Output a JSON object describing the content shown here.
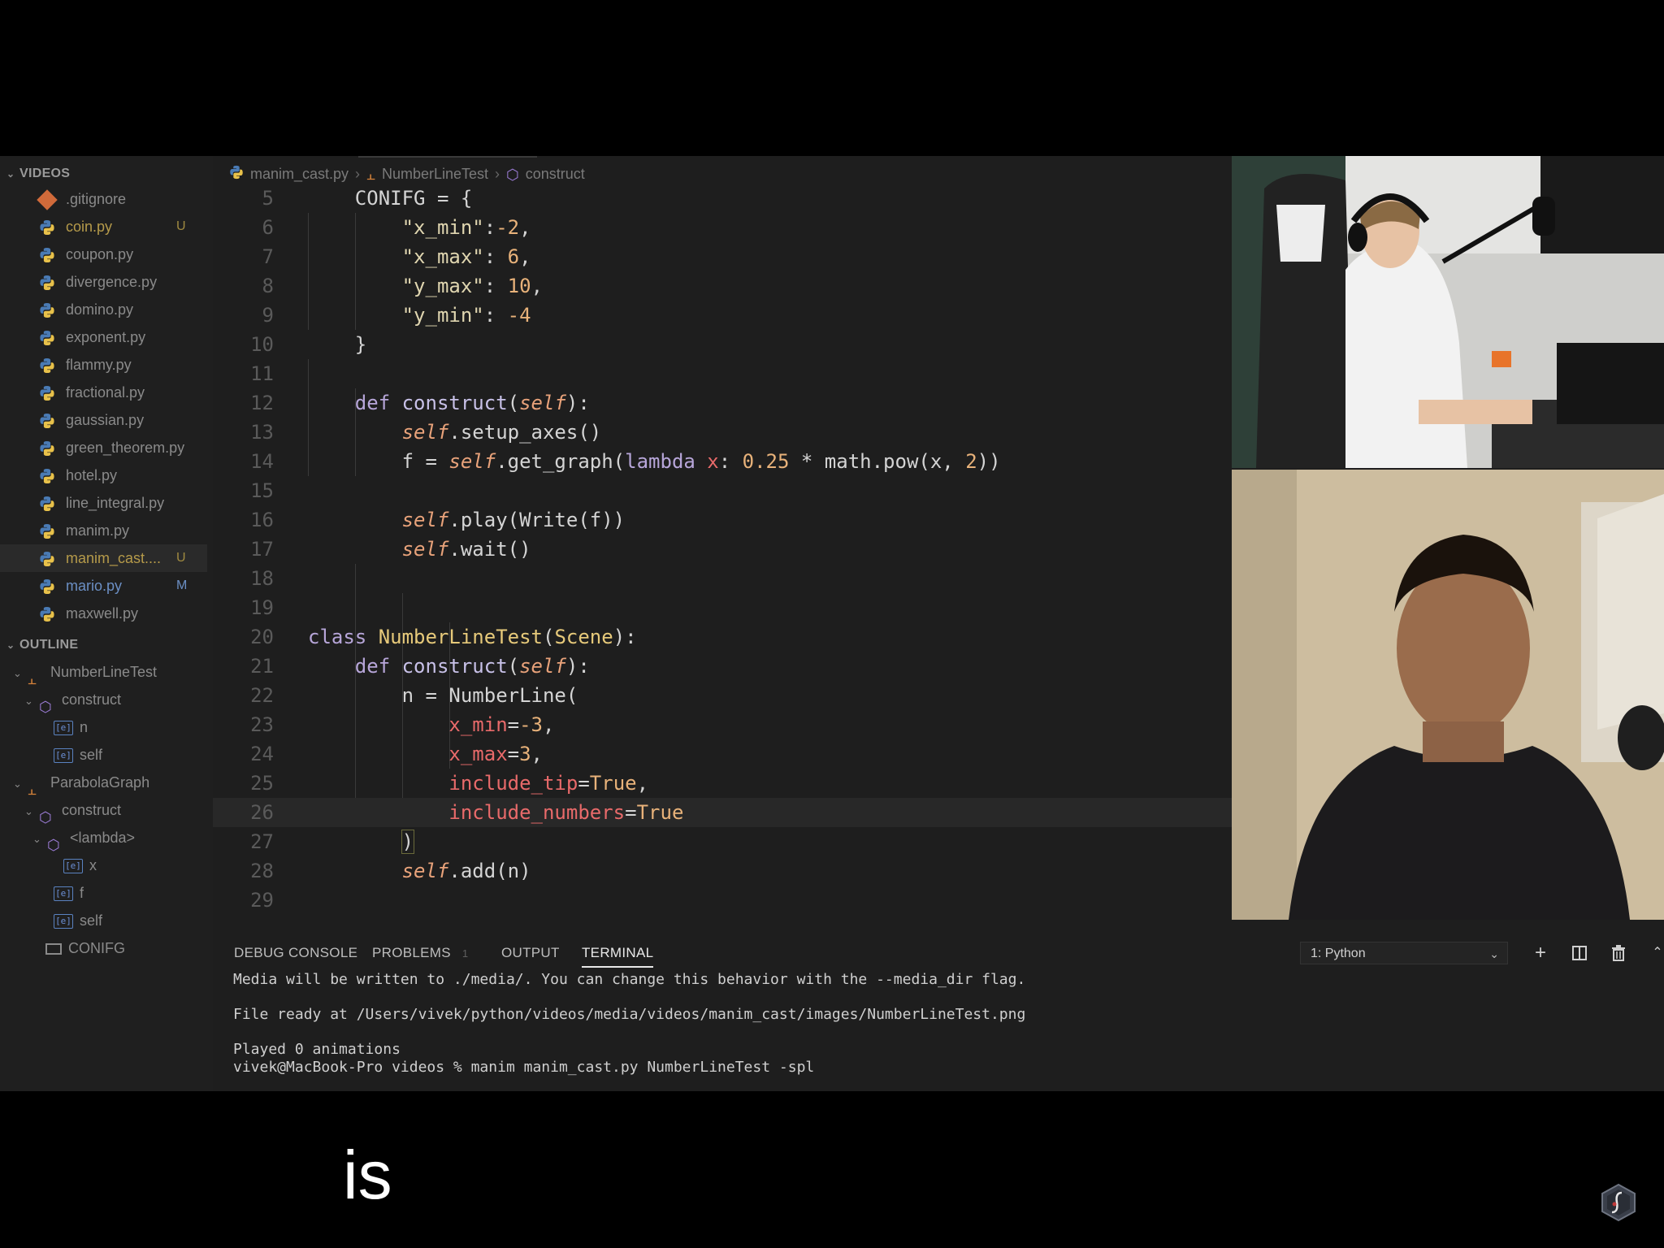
{
  "sidebar": {
    "explorer_header": "VIDEOS",
    "files": [
      {
        "name": ".gitignore",
        "icon": "git-icon",
        "badge": ""
      },
      {
        "name": "coin.py",
        "icon": "python-icon",
        "badge": "U"
      },
      {
        "name": "coupon.py",
        "icon": "python-icon",
        "badge": ""
      },
      {
        "name": "divergence.py",
        "icon": "python-icon",
        "badge": ""
      },
      {
        "name": "domino.py",
        "icon": "python-icon",
        "badge": ""
      },
      {
        "name": "exponent.py",
        "icon": "python-icon",
        "badge": ""
      },
      {
        "name": "flammy.py",
        "icon": "python-icon",
        "badge": ""
      },
      {
        "name": "fractional.py",
        "icon": "python-icon",
        "badge": ""
      },
      {
        "name": "gaussian.py",
        "icon": "python-icon",
        "badge": ""
      },
      {
        "name": "green_theorem.py",
        "icon": "python-icon",
        "badge": ""
      },
      {
        "name": "hotel.py",
        "icon": "python-icon",
        "badge": ""
      },
      {
        "name": "line_integral.py",
        "icon": "python-icon",
        "badge": ""
      },
      {
        "name": "manim.py",
        "icon": "python-icon",
        "badge": ""
      },
      {
        "name": "manim_cast....",
        "icon": "python-icon",
        "badge": "U"
      },
      {
        "name": "mario.py",
        "icon": "python-icon",
        "badge": "M"
      },
      {
        "name": "maxwell.py",
        "icon": "python-icon",
        "badge": ""
      }
    ],
    "outline_header": "OUTLINE",
    "outline": [
      {
        "label": "NumberLineTest",
        "kind": "class"
      },
      {
        "label": "construct",
        "kind": "method"
      },
      {
        "label": "n",
        "kind": "variable"
      },
      {
        "label": "self",
        "kind": "variable"
      },
      {
        "label": "ParabolaGraph",
        "kind": "class"
      },
      {
        "label": "construct",
        "kind": "method"
      },
      {
        "label": "<lambda>",
        "kind": "method"
      },
      {
        "label": "x",
        "kind": "variable"
      },
      {
        "label": "f",
        "kind": "variable"
      },
      {
        "label": "self",
        "kind": "variable"
      },
      {
        "label": "CONIFG",
        "kind": "constant"
      }
    ]
  },
  "breadcrumb": {
    "file": "manim_cast.py",
    "class": "NumberLineTest",
    "method": "construct"
  },
  "code": {
    "line_numbers": [
      "5",
      "6",
      "7",
      "8",
      "9",
      "10",
      "11",
      "12",
      "13",
      "14",
      "15",
      "16",
      "17",
      "18",
      "19",
      "20",
      "21",
      "22",
      "23",
      "24",
      "25",
      "26",
      "27",
      "28",
      "29"
    ],
    "current_line": "26"
  },
  "panel": {
    "tabs": {
      "debug_console": "DEBUG CONSOLE",
      "problems": "PROBLEMS",
      "problems_count": "1",
      "output": "OUTPUT",
      "terminal": "TERMINAL"
    },
    "terminal_select": "1: Python",
    "terminal_lines": [
      "Media will be written to ./media/. You can change this behavior with the --media_dir flag.",
      "",
      "File ready at /Users/vivek/python/videos/media/videos/manim_cast/images/NumberLineTest.png",
      "",
      "Played 0 animations",
      "vivek@MacBook-Pro videos % manim manim_cast.py NumberLineTest -spl"
    ]
  },
  "subtitle": "is",
  "colors": {
    "editor_bg": "#1e1e1e",
    "sidebar_bg": "#1f1f1f",
    "keyword": "#b7a6d9",
    "self": "#e8a27a",
    "param": "#e86a6a",
    "class_name": "#e6c97a",
    "untracked": "#b59a4a",
    "modified": "#6b8fc4"
  }
}
